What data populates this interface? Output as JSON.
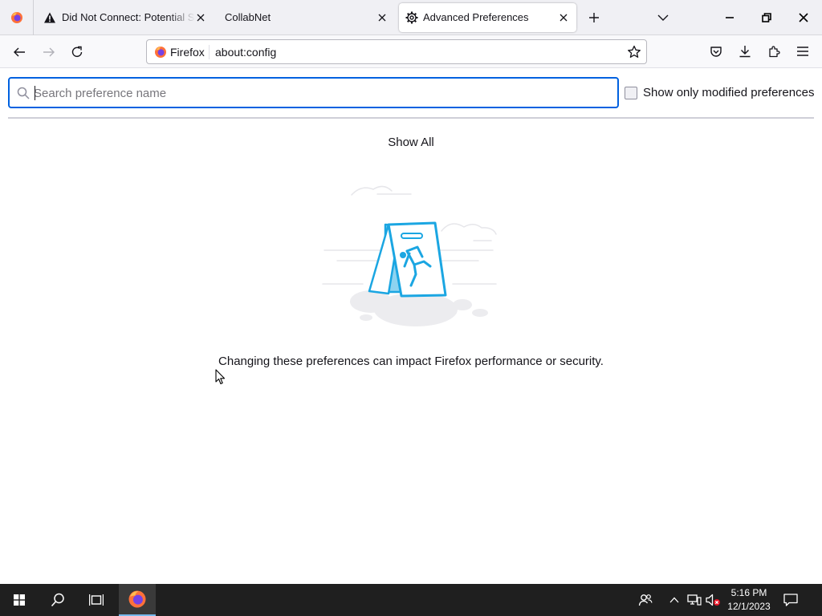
{
  "tabs": [
    {
      "title": "Did Not Connect: Potential Security Issue",
      "icon": "warning-icon",
      "active": false
    },
    {
      "title": "CollabNet",
      "icon": "",
      "active": false
    },
    {
      "title": "Advanced Preferences",
      "icon": "gear-icon",
      "active": true
    }
  ],
  "navbar": {
    "identity_label": "Firefox",
    "url": "about:config"
  },
  "config": {
    "search_placeholder": "Search preference name",
    "search_value": "",
    "show_modified_label": "Show only modified preferences",
    "show_modified_checked": false,
    "show_all_label": "Show All",
    "warning_text": "Changing these preferences can impact Firefox performance or security."
  },
  "taskbar": {
    "time": "5:16 PM",
    "date": "12/1/2023"
  },
  "colors": {
    "accent": "#0061e0",
    "illustration_blue": "#1ba6e2",
    "taskbar": "#1f1f1f"
  }
}
